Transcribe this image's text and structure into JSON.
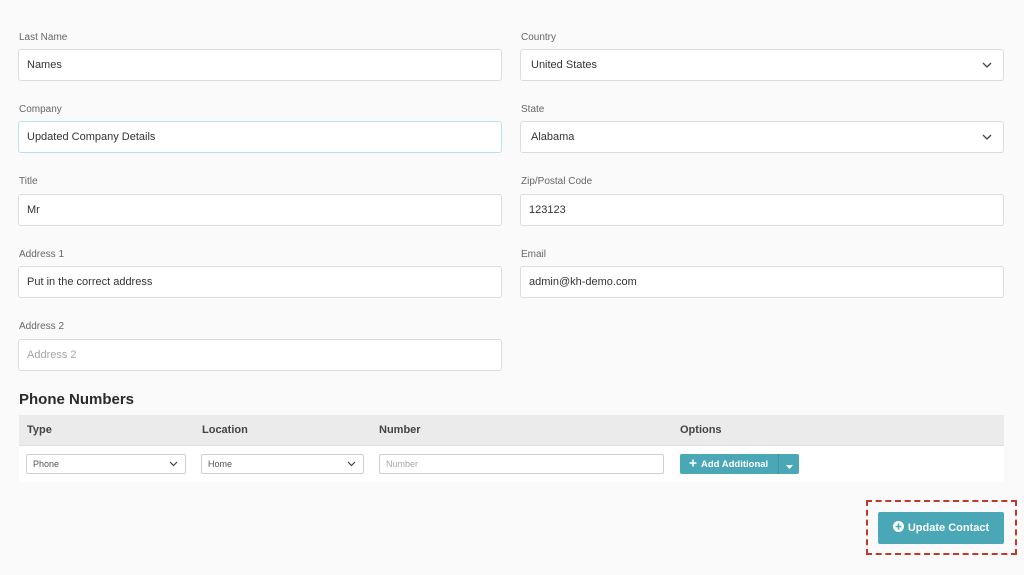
{
  "form": {
    "last_name": {
      "label": "Last Name",
      "value": "Names"
    },
    "country": {
      "label": "Country",
      "value": "United States"
    },
    "company": {
      "label": "Company",
      "value": "Updated Company Details"
    },
    "state": {
      "label": "State",
      "value": "Alabama"
    },
    "title": {
      "label": "Title",
      "value": "Mr"
    },
    "zip": {
      "label": "Zip/Postal Code",
      "value": "123123"
    },
    "address1": {
      "label": "Address 1",
      "value": "Put in the correct address"
    },
    "email": {
      "label": "Email",
      "value": "admin@kh-demo.com"
    },
    "address2": {
      "label": "Address 2",
      "value": "",
      "placeholder": "Address 2"
    }
  },
  "phone_numbers": {
    "title": "Phone Numbers",
    "columns": [
      "Type",
      "Location",
      "Number",
      "Options"
    ],
    "row": {
      "type": "Phone",
      "location": "Home",
      "number_placeholder": "Number",
      "add_label": "Add Additional"
    }
  },
  "actions": {
    "update_label": "Update Contact"
  },
  "colors": {
    "accent": "#4aa7b6",
    "highlight": "#c0392b"
  },
  "icons": {
    "dropdown": "chevron-down-icon",
    "add": "plus-icon",
    "update": "plus-circle-icon"
  }
}
